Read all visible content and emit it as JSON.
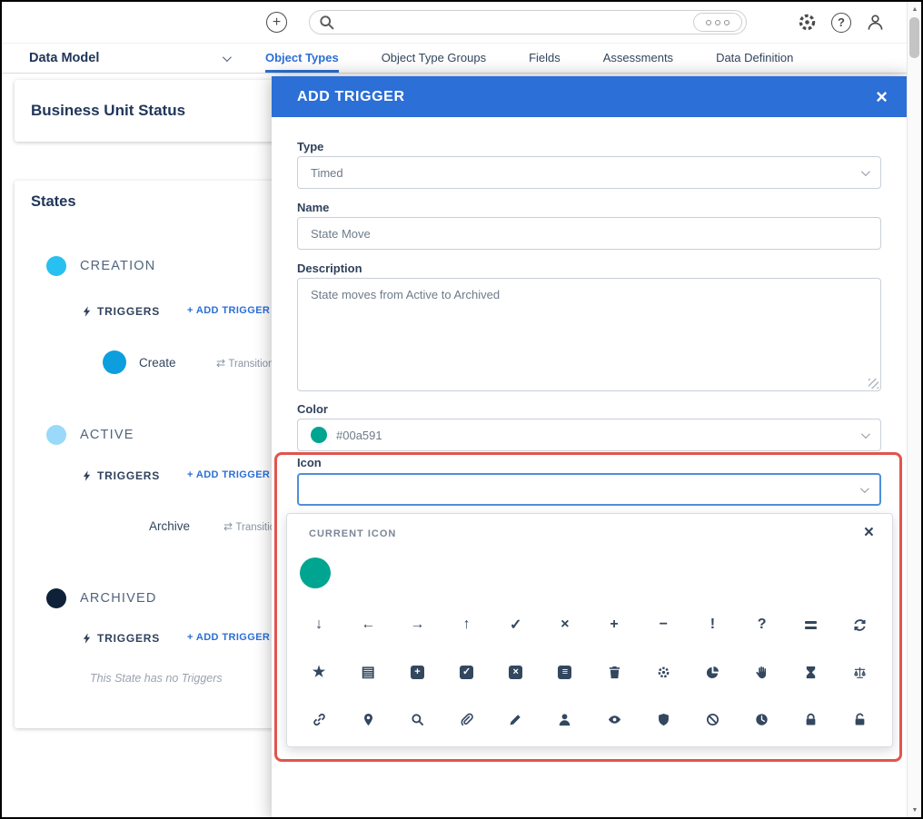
{
  "colors": {
    "accent_blue": "#2b6fd7",
    "teal": "#00a591",
    "highlight_red": "#e0554d",
    "icon_navy": "#33475f"
  },
  "topbar": {
    "search": {
      "placeholder": "",
      "value": ""
    },
    "icon_names": [
      "plus-circle-icon",
      "search-icon",
      "ellipsis-icon",
      "gear-icon",
      "help-icon",
      "user-icon"
    ],
    "help_glyph": "?",
    "plus_glyph": "+"
  },
  "nav": {
    "dropdown_label": "Data Model",
    "tabs": [
      {
        "label": "Object Types",
        "active": true
      },
      {
        "label": "Object Type Groups",
        "active": false
      },
      {
        "label": "Fields",
        "active": false
      },
      {
        "label": "Assessments",
        "active": false
      },
      {
        "label": "Data Definition",
        "active": false
      }
    ]
  },
  "content": {
    "page_title": "Business Unit Status",
    "states_heading": "States",
    "triggers_label": "TRIGGERS",
    "add_trigger_label": "+ ADD TRIGGER",
    "states": [
      {
        "name": "CREATION",
        "color": "#27c0f0",
        "items": [
          {
            "name": "Create",
            "color": "#0d9fdd",
            "transition_text": "Transitions t"
          }
        ]
      },
      {
        "name": "ACTIVE",
        "color": "#9ad9f9",
        "items": [
          {
            "name": "Archive",
            "transition_text": "Transitions"
          }
        ]
      },
      {
        "name": "ARCHIVED",
        "color": "#0e2139",
        "empty_text": "This State has no Triggers",
        "items": []
      }
    ]
  },
  "modal": {
    "title": "ADD TRIGGER",
    "close_glyph": "×",
    "fields": {
      "type": {
        "label": "Type",
        "value": "Timed"
      },
      "name": {
        "label": "Name",
        "value": "State Move"
      },
      "description": {
        "label": "Description",
        "value": "State moves from Active to Archived"
      },
      "color": {
        "label": "Color",
        "value": "#00a591",
        "swatch": "#00a591"
      },
      "icon": {
        "label": "Icon",
        "value": ""
      }
    },
    "icon_picker": {
      "current_icon_label": "CURRENT ICON",
      "current_icon_color": "#00a591",
      "clear_glyph": "×",
      "icons": [
        "arrow-down",
        "arrow-left",
        "arrow-right",
        "arrow-up",
        "check",
        "times",
        "plus",
        "minus",
        "exclamation",
        "question",
        "grip-lines",
        "sync",
        "star",
        "file-lines",
        "square-plus",
        "square-check",
        "square-x",
        "list",
        "trash",
        "gear",
        "chart-pie",
        "hand",
        "hourglass",
        "balance-scale",
        "link",
        "map-marker",
        "search",
        "paperclip",
        "pencil",
        "user",
        "eye",
        "shield",
        "ban",
        "clock",
        "lock",
        "unlock"
      ]
    }
  },
  "scrollbar": {
    "up_glyph": "▲",
    "down_glyph": "▼"
  }
}
